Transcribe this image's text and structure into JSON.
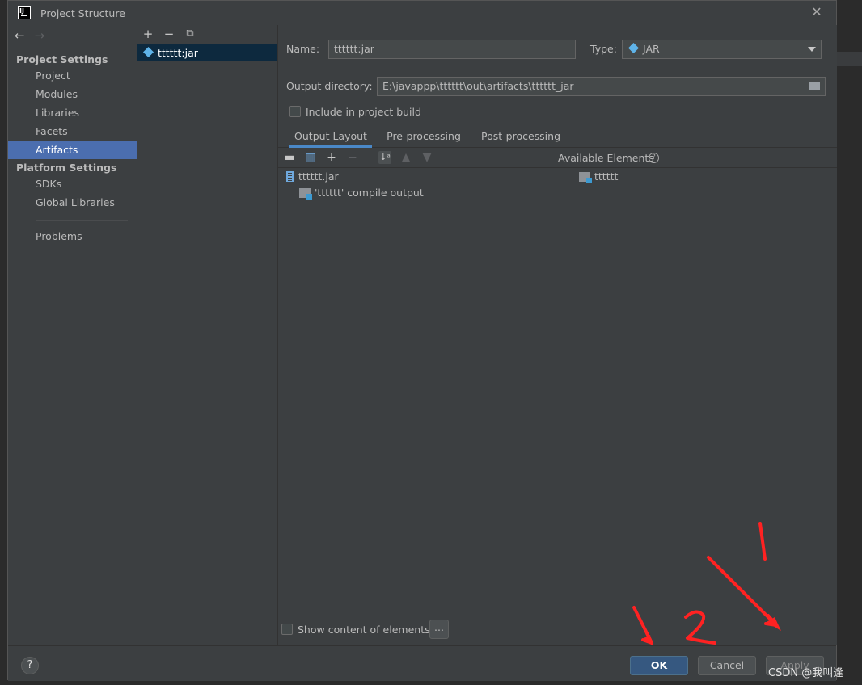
{
  "dialog": {
    "title": "Project Structure"
  },
  "nav": {
    "sections": [
      {
        "label": "Project Settings",
        "items": [
          "Project",
          "Modules",
          "Libraries",
          "Facets",
          "Artifacts"
        ]
      },
      {
        "label": "Platform Settings",
        "items": [
          "SDKs",
          "Global Libraries"
        ]
      }
    ],
    "problems": "Problems",
    "selected": "Artifacts"
  },
  "artifacts": {
    "items": [
      "tttttt:jar"
    ]
  },
  "form": {
    "name_label": "Name:",
    "name_value": "tttttt:jar",
    "type_label": "Type:",
    "type_value": "JAR",
    "output_label": "Output directory:",
    "output_value": "E:\\javappp\\tttttt\\out\\artifacts\\tttttt_jar",
    "include_build_label": "Include in project build"
  },
  "tabs": [
    "Output Layout",
    "Pre-processing",
    "Post-processing"
  ],
  "layout": {
    "tree": [
      "tttttt.jar",
      "'tttttt' compile output"
    ],
    "available_label": "Available Elements",
    "available_items": [
      "tttttt"
    ],
    "show_content_label": "Show content of elements",
    "ellipsis": "..."
  },
  "buttons": {
    "ok": "OK",
    "cancel": "Cancel",
    "apply": "Apply",
    "help": "?"
  },
  "annotations": {
    "mark1": "1",
    "mark2": "2",
    "color": "#ff2222"
  },
  "watermark": "CSDN @我叫逢"
}
